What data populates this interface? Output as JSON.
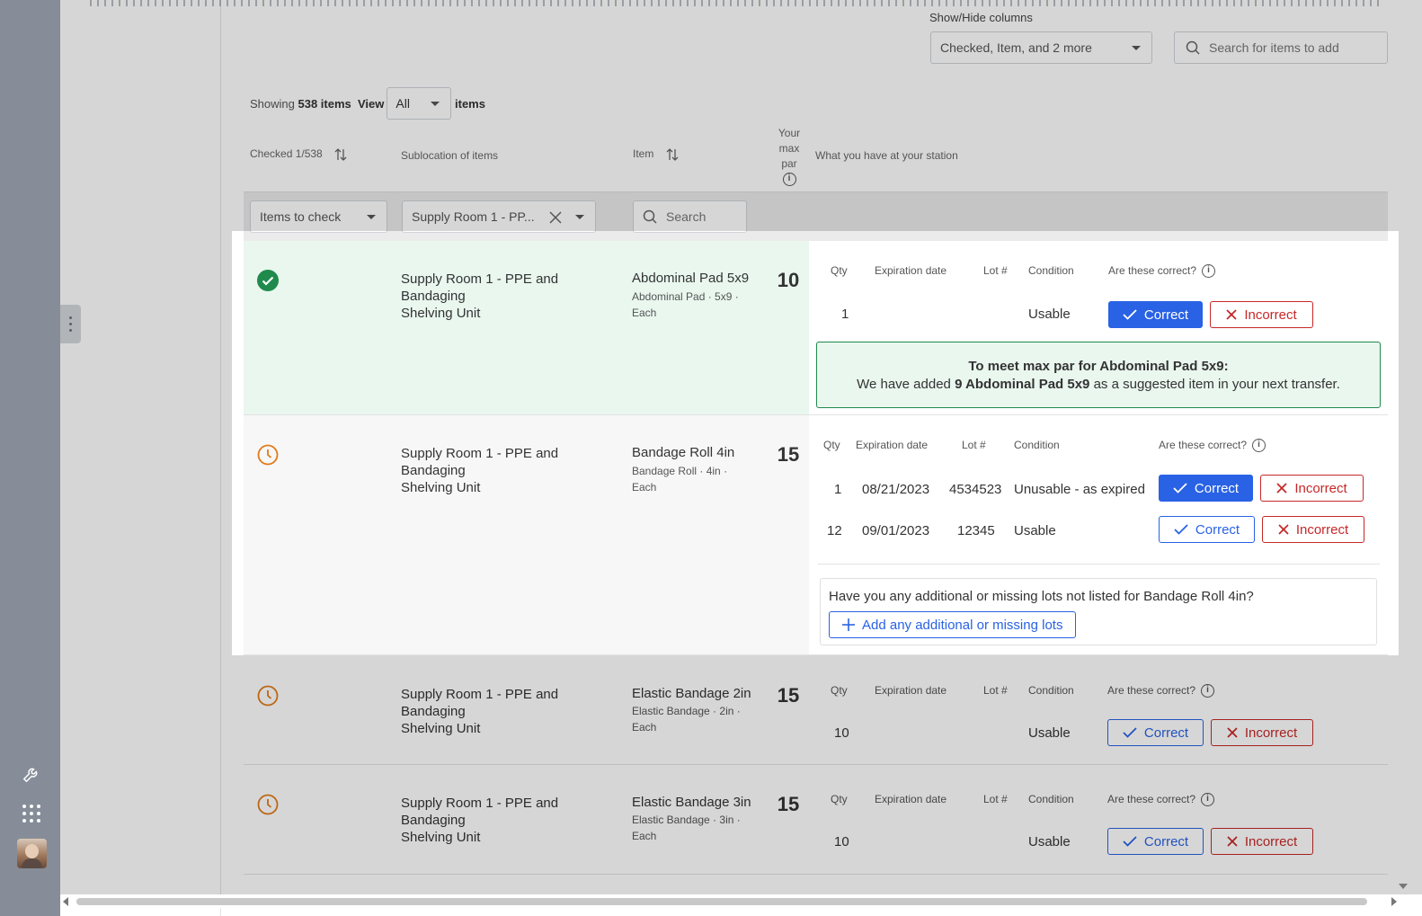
{
  "toolbar": {
    "showhide_label": "Show/Hide columns",
    "columns_value": "Checked, Item, and 2 more",
    "search_placeholder": "Search for items to add"
  },
  "showing": {
    "prefix": "Showing",
    "count": "538 items",
    "view_label": "View",
    "view_value": "All",
    "suffix": "items"
  },
  "headers": {
    "checked": "Checked 1/538",
    "sublocation": "Sublocation of items",
    "item": "Item",
    "maxpar_1": "Your",
    "maxpar_2": "max",
    "maxpar_3": "par",
    "station": "What you have at your station"
  },
  "filters": {
    "checked_value": "Items to check",
    "sublocation_value": "Supply Room 1 - PP...",
    "item_search_placeholder": "Search"
  },
  "lot_headers": {
    "qty": "Qty",
    "expiration": "Expiration date",
    "lot": "Lot #",
    "condition": "Condition",
    "correct_q": "Are these correct?"
  },
  "buttons": {
    "correct": "Correct",
    "incorrect": "Incorrect",
    "add_lots": "Add any additional or missing lots"
  },
  "rows": [
    {
      "sublocation_1": "Supply Room 1 - PPE and Bandaging",
      "sublocation_2": "Shelving Unit",
      "item": "Abdominal Pad 5x9",
      "item_sub_1": "Abdominal Pad · 5x9 ·",
      "item_sub_2": "Each",
      "maxpar": "10",
      "status": "checked",
      "lots": [
        {
          "qty": "1",
          "expiration": "",
          "lot": "",
          "condition": "Usable"
        }
      ]
    },
    {
      "sublocation_1": "Supply Room 1 - PPE and Bandaging",
      "sublocation_2": "Shelving Unit",
      "item": "Bandage Roll 4in",
      "item_sub_1": "Bandage Roll · 4in ·",
      "item_sub_2": "Each",
      "maxpar": "15",
      "status": "pending",
      "lots": [
        {
          "qty": "1",
          "expiration": "08/21/2023",
          "lot": "4534523",
          "condition": "Unusable - as expired"
        },
        {
          "qty": "12",
          "expiration": "09/01/2023",
          "lot": "12345",
          "condition": "Usable"
        }
      ]
    },
    {
      "sublocation_1": "Supply Room 1 - PPE and Bandaging",
      "sublocation_2": "Shelving Unit",
      "item": "Elastic Bandage 2in",
      "item_sub_1": "Elastic Bandage · 2in ·",
      "item_sub_2": "Each",
      "maxpar": "15",
      "status": "pending",
      "lots": [
        {
          "qty": "10",
          "expiration": "",
          "lot": "",
          "condition": "Usable"
        }
      ]
    },
    {
      "sublocation_1": "Supply Room 1 - PPE and Bandaging",
      "sublocation_2": "Shelving Unit",
      "item": "Elastic Bandage 3in",
      "item_sub_1": "Elastic Bandage · 3in ·",
      "item_sub_2": "Each",
      "maxpar": "15",
      "status": "pending",
      "lots": [
        {
          "qty": "10",
          "expiration": "",
          "lot": "",
          "condition": "Usable"
        }
      ]
    }
  ],
  "suggestion": {
    "title": "To meet max par for Abdominal Pad 5x9:",
    "pre": "We have added",
    "strong": "9 Abdominal Pad 5x9",
    "post": "as a suggested item in your next transfer."
  },
  "missing": {
    "question": "Have you any additional or missing lots not listed for Bandage Roll 4in?"
  },
  "colors": {
    "accent": "#2962e4",
    "danger": "#c62828",
    "success": "#1f8a4c",
    "pending": "#e07b1a"
  }
}
